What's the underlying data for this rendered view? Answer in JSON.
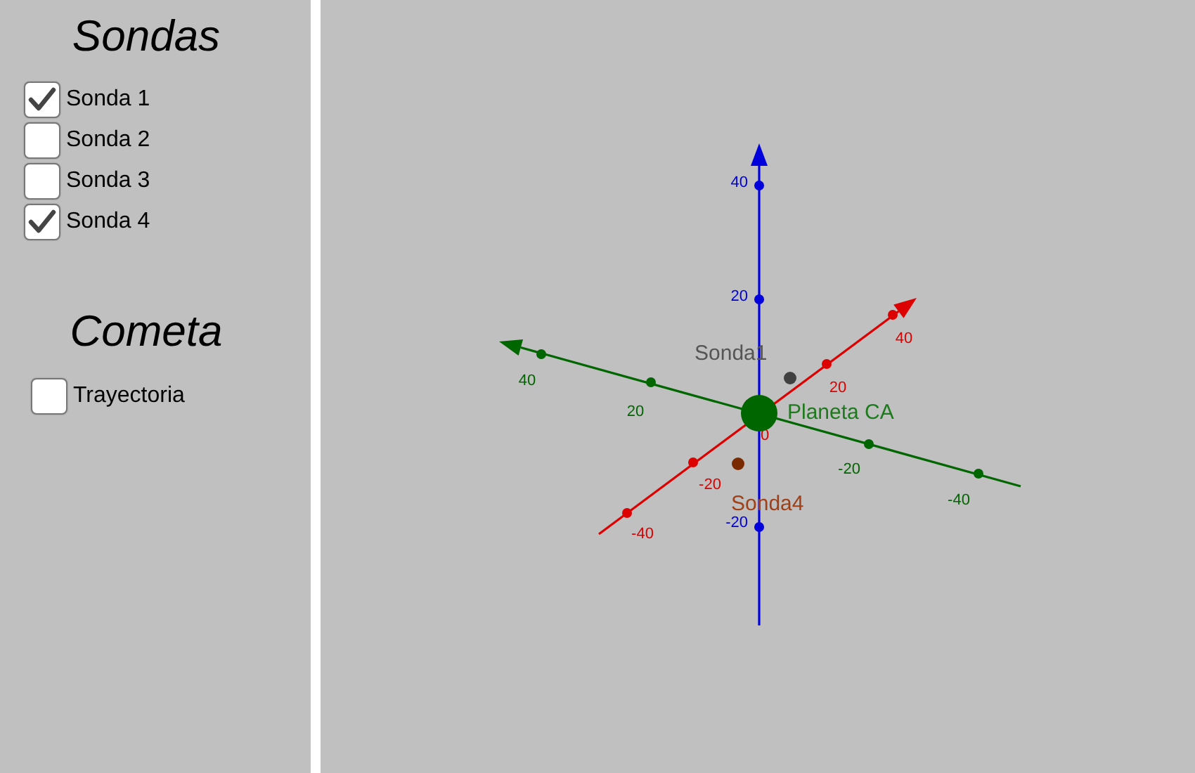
{
  "sidebar": {
    "sections": [
      {
        "title": "Sondas",
        "options": [
          {
            "label": "Sonda 1",
            "checked": true
          },
          {
            "label": "Sonda 2",
            "checked": false
          },
          {
            "label": "Sonda 3",
            "checked": false
          },
          {
            "label": "Sonda 4",
            "checked": true
          }
        ]
      },
      {
        "title": "Cometa",
        "options": [
          {
            "label": "Trayectoria",
            "checked": false
          }
        ]
      }
    ]
  },
  "view3d": {
    "axes": [
      {
        "kind": "x",
        "color": "#dd0000",
        "ticks": [
          "40",
          "20",
          "0",
          "-20",
          "-40"
        ]
      },
      {
        "kind": "y",
        "color": "#006600",
        "ticks": [
          "40",
          "20",
          "-20",
          "-40"
        ]
      },
      {
        "kind": "z",
        "color": "#0000dd",
        "ticks": [
          "40",
          "20",
          "-20"
        ]
      }
    ],
    "objects": [
      {
        "kind": "probe",
        "label": "Sonda1",
        "color": "#404040"
      },
      {
        "kind": "planet",
        "label": "Planeta CA",
        "color": "#006600"
      },
      {
        "kind": "probe",
        "label": "Sonda4",
        "color": "#7a2a00"
      }
    ]
  }
}
